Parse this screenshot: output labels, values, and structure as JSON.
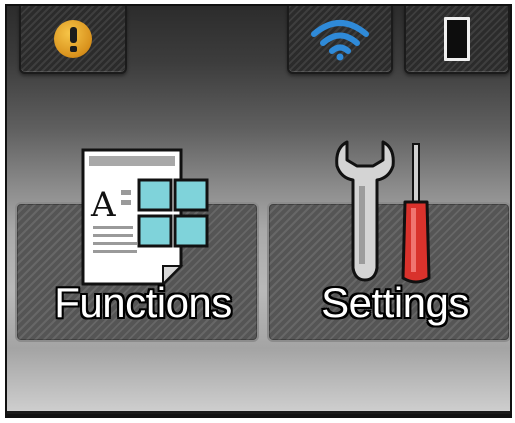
{
  "status_bar": {
    "warning_icon": "warning-icon",
    "wifi_icon": "wifi-icon",
    "memory_card_icon": "memory-card-icon",
    "wifi_color": "#2f8ad8",
    "warning_color": "#e4a22a"
  },
  "tiles": [
    {
      "label": "Functions",
      "icon": "functions-icon"
    },
    {
      "label": "Settings",
      "icon": "settings-icon"
    }
  ]
}
